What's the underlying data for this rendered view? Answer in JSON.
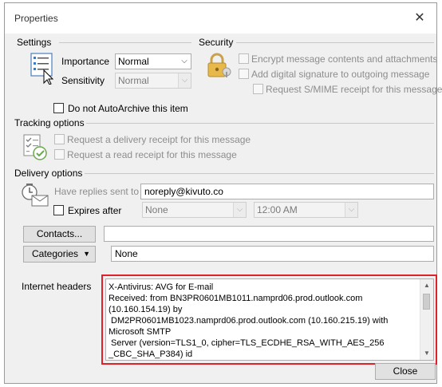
{
  "window": {
    "title": "Properties",
    "close_glyph": "✕"
  },
  "settings": {
    "label": "Settings",
    "importance_label": "Importance",
    "importance_value": "Normal",
    "sensitivity_label": "Sensitivity",
    "sensitivity_value": "Normal",
    "autoarchive_label": "Do not AutoArchive this item",
    "icon": "properties-list-icon"
  },
  "security": {
    "label": "Security",
    "encrypt_label": "Encrypt message contents and attachments",
    "signature_label": "Add digital signature to outgoing message",
    "smime_label": "Request S/MIME receipt for this message",
    "icon": "padlock-icon"
  },
  "tracking": {
    "label": "Tracking options",
    "delivery_receipt_label": "Request a delivery receipt for this message",
    "read_receipt_label": "Request a read receipt for this message",
    "icon": "checklist-icon"
  },
  "delivery": {
    "label": "Delivery options",
    "replies_label": "Have replies sent to",
    "replies_value": "noreply@kivuto.co",
    "expires_label": "Expires after",
    "expires_date": "None",
    "expires_time": "12:00 AM",
    "icon": "clock-envelope-icon"
  },
  "contacts": {
    "button_label": "Contacts...",
    "value": ""
  },
  "categories": {
    "button_label": "Categories",
    "value": "None"
  },
  "internet_headers": {
    "label": "Internet headers",
    "lines": [
      "X-Antivirus: AVG for E-mail",
      "Received: from BN3PR0601MB1011.namprd06.prod.outlook.com",
      "(10.160.154.19) by",
      " DM2PR0601MB1023.namprd06.prod.outlook.com (10.160.215.19) with",
      "Microsoft SMTP",
      " Server (version=TLS1_0, cipher=TLS_ECDHE_RSA_WITH_AES_256",
      "_CBC_SHA_P384) id"
    ]
  },
  "footer": {
    "close_label": "Close"
  },
  "colors": {
    "highlight": "#e0202a",
    "dialog_bg": "#f0f0f0"
  }
}
